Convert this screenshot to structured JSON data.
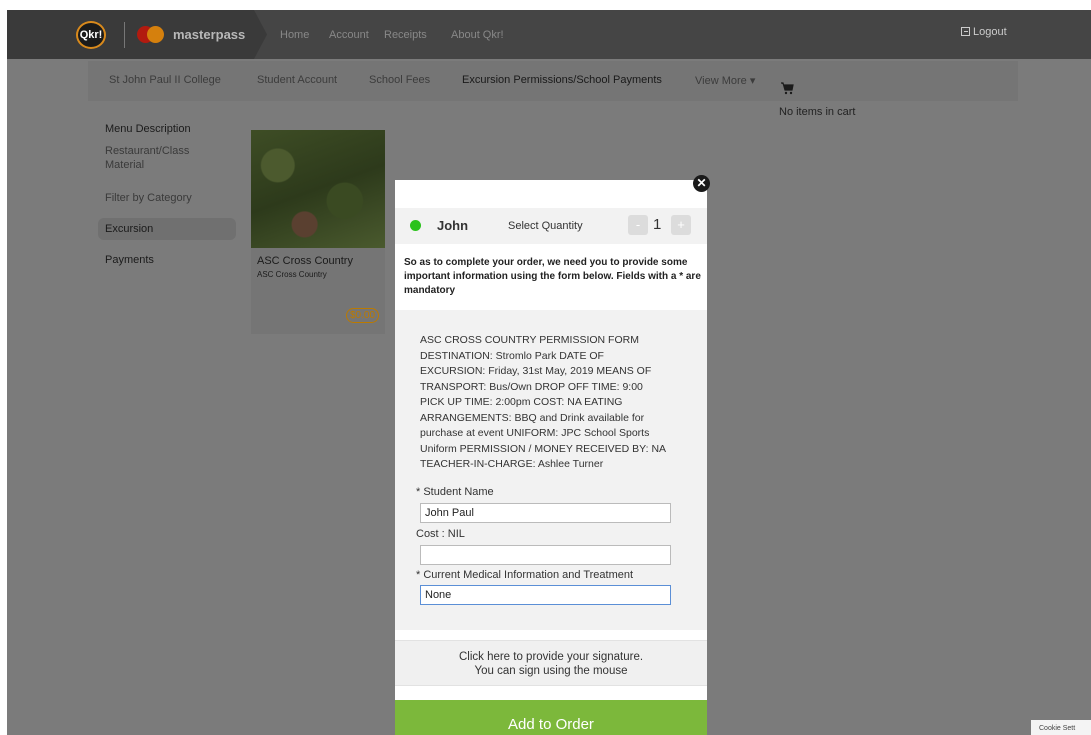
{
  "header": {
    "logo_text": "Qkr!",
    "brand": "masterpass",
    "nav": [
      "Home",
      "Account",
      "Receipts",
      "About Qkr!"
    ],
    "logout": "Logout"
  },
  "subnav": {
    "school": "St John Paul II College",
    "items": [
      "Student Account",
      "School Fees",
      "Excursion Permissions/School Payments",
      "View More ▾"
    ],
    "cart_empty": "No items in cart"
  },
  "sidebar": {
    "heading": "Menu Description",
    "items": [
      "Restaurant/Class Material",
      "Filter by Category",
      "Excursion",
      "Payments"
    ]
  },
  "product": {
    "title": "ASC Cross Country",
    "subtitle": "ASC Cross Country",
    "price": "$0.00"
  },
  "modal": {
    "student": "John",
    "quantity_label": "Select Quantity",
    "minus": "-",
    "plus": "+",
    "quantity": "1",
    "intro": "So as to complete your order, we need you to provide some important information using the form below. Fields with a * are mandatory",
    "description": "ASC CROSS COUNTRY PERMISSION FORM DESTINATION: Stromlo Park DATE OF EXCURSION: Friday, 31st May, 2019 MEANS OF TRANSPORT: Bus/Own DROP OFF TIME: 9:00 PICK UP TIME: 2:00pm COST: NA EATING ARRANGEMENTS: BBQ and Drink available for purchase at event UNIFORM: JPC School Sports Uniform PERMISSION / MONEY RECEIVED BY: NA TEACHER-IN-CHARGE: Ashlee Turner",
    "fields": [
      {
        "label": "* Student Name",
        "value": "John Paul"
      },
      {
        "label": "Cost : NIL",
        "value": ""
      },
      {
        "label": "* Current Medical Information and Treatment",
        "value": "None"
      }
    ],
    "signature_line1": "Click here to provide your signature.",
    "signature_line2": "You can sign using the mouse",
    "submit": "Add to Order"
  },
  "cookie": "Cookie Sett"
}
